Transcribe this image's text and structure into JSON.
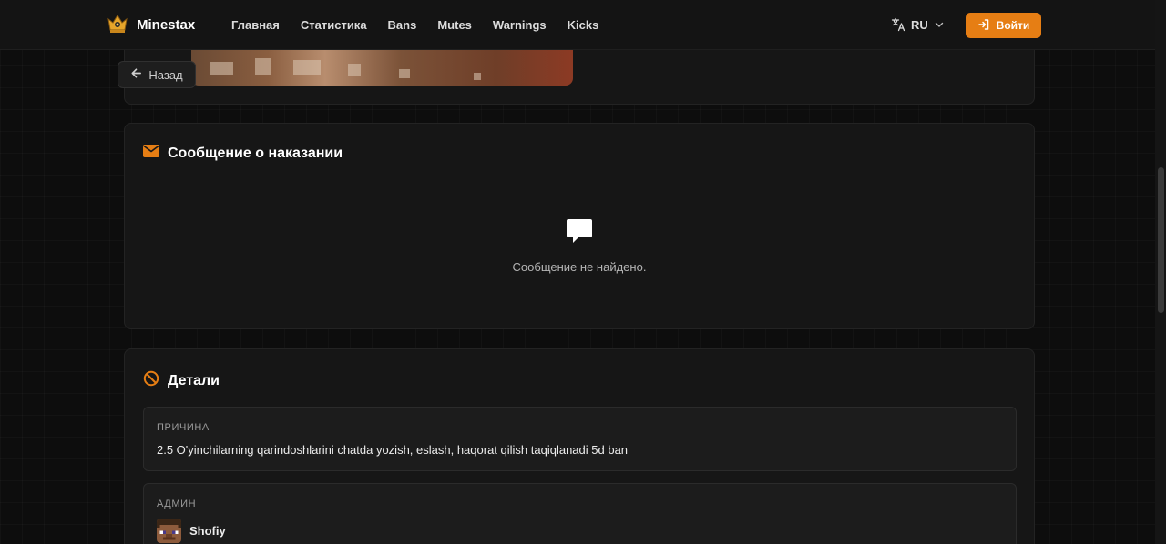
{
  "brand": {
    "name": "Minestax"
  },
  "nav": {
    "links": [
      "Главная",
      "Статистика",
      "Bans",
      "Mutes",
      "Warnings",
      "Kicks"
    ]
  },
  "language": {
    "selected": "RU"
  },
  "login": {
    "label": "Войти"
  },
  "back": {
    "label": "Назад"
  },
  "message_card": {
    "title": "Сообщение о наказании",
    "empty_text": "Сообщение не найдено."
  },
  "details_card": {
    "title": "Детали",
    "reason_label": "ПРИЧИНА",
    "reason_value": "2.5 O'yinchilarning qarindoshlarini chatda yozish, eslash, haqorat qilish taqiqlanadi 5d ban",
    "admin_label": "АДМИН",
    "admin_name": "Shofiy"
  },
  "colors": {
    "accent": "#e67e14",
    "background": "#0d0d0d",
    "card": "#161616"
  },
  "icons": {
    "logo": "crown-logo-icon",
    "lang": "translate-icon",
    "lang_chevron": "chevron-down-icon",
    "login": "login-icon",
    "back": "arrow-left-icon",
    "message_title": "envelope-icon",
    "empty": "chat-bubble-icon",
    "details_title": "ban-icon"
  }
}
